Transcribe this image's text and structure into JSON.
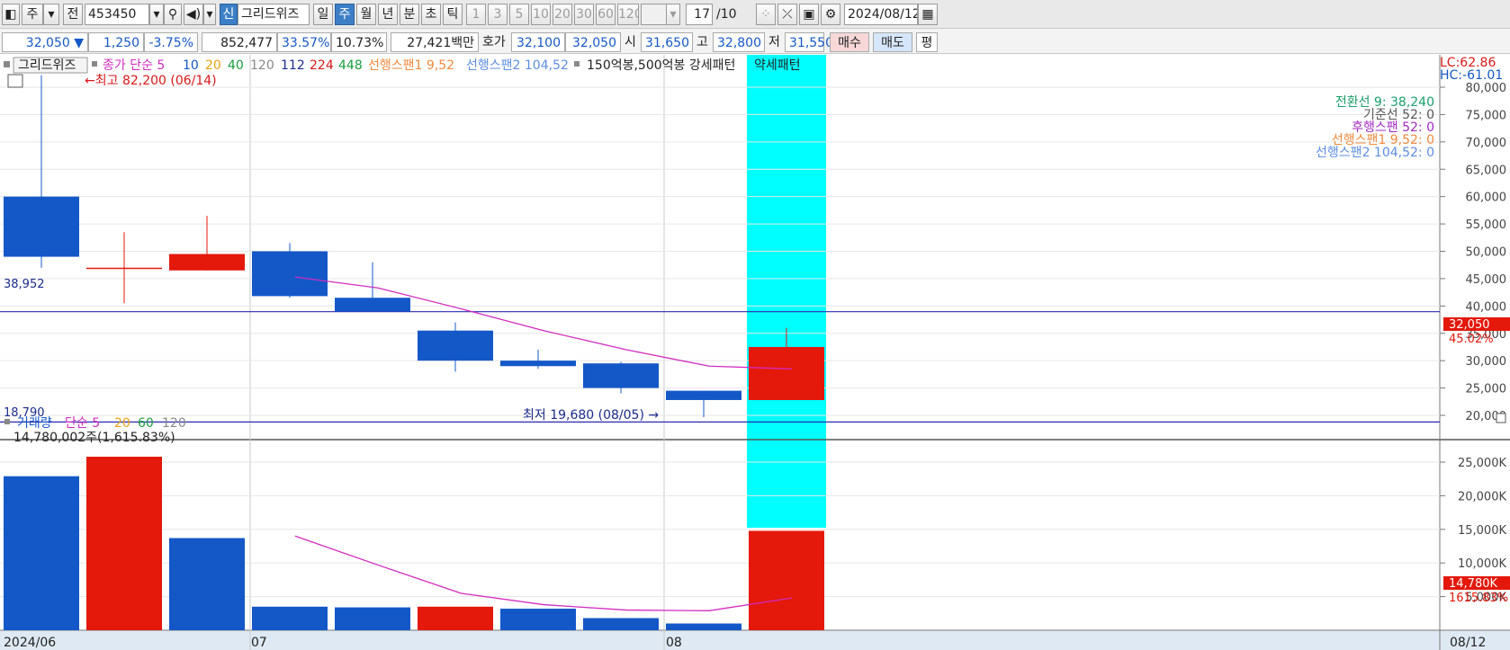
{
  "toolbar": {
    "period_label": "주",
    "prev_label": "전",
    "code": "453450",
    "new_label": "신",
    "indicator_name": "그리드위즈",
    "day_label": "일",
    "week_label": "주",
    "month_label": "월",
    "year_label": "년",
    "minute_label": "분",
    "second_label": "초",
    "tick_label": "틱",
    "numbers": [
      "1",
      "3",
      "5",
      "10",
      "20",
      "30",
      "60",
      "120"
    ],
    "count": "17",
    "count_total": "/10",
    "date": "2024/08/12"
  },
  "info": {
    "price": "32,050 ▼",
    "change": "1,250",
    "change_pct": "-3.75%",
    "volume": "852,477",
    "vol_pct": "33.57%",
    "turnover": "10.73%",
    "amount": "27,421백만",
    "hoga_label": "호가",
    "ask": "32,100",
    "bid": "32,050",
    "open_label": "시",
    "open": "31,650",
    "high_label": "고",
    "high": "32,800",
    "low_label": "저",
    "low": "31,550",
    "buy_label": "매수",
    "sell_label": "매도",
    "eval_label": "평"
  },
  "legend": {
    "name": "그리드위즈",
    "close_ma": "종가 단순 5",
    "ma10": "10",
    "ma20": "20",
    "ma40": "40",
    "ma120": "120",
    "ma112": "112",
    "ma224": "224",
    "ma448": "448",
    "span1": "선행스팬1 9,52",
    "span2": "선행스팬2 104,52",
    "pattern": "150억봉,500억봉 강세패턴",
    "weak_pattern": "약세패턴"
  },
  "right_info": {
    "lc": "LC:62.86",
    "hc": "HC:-61.01",
    "conv": "전환선 9: 38,240",
    "base": "기준선 52: 0",
    "lag": "후행스팬 52: 0",
    "lead1": "선행스팬1 9,52: 0",
    "lead2": "선행스팬2 104,52: 0"
  },
  "annotations": {
    "high_marker": "←최고 82,200 (06/14)",
    "low_marker": "최저 19,680 (08/05) →",
    "line_hi_label": "38,952",
    "line_lo_label": "18,790",
    "price_tag": "32,050",
    "price_tag_pct": "45.02%",
    "vol_title": "거래량",
    "vol_ma": "단순 5",
    "vol_ma20": "20",
    "vol_ma60": "60",
    "vol_ma120": "120",
    "vol_value": "14,780,002주(1,615.83%)",
    "vol_tag": "14,780K",
    "vol_tag_pct": "1615.83%"
  },
  "x_labels": [
    "2024/06",
    "07",
    "08",
    "08/12"
  ],
  "colors": {
    "up": "#e4180b",
    "down": "#1458c8",
    "ma": "#d22bbf",
    "highlight": "#00ffff",
    "hline": "#2a2ab5"
  },
  "chart_data": {
    "type": "candlestick",
    "price_axis": {
      "ylim": [
        15000,
        85000
      ],
      "ticks": [
        20000,
        25000,
        30000,
        35000,
        40000,
        45000,
        50000,
        55000,
        60000,
        65000,
        70000,
        75000,
        80000
      ]
    },
    "candles": [
      {
        "open": 60000,
        "high": 82200,
        "low": 47000,
        "close": 49000
      },
      {
        "open": 47000,
        "high": 53500,
        "low": 40500,
        "close": 47000
      },
      {
        "open": 46500,
        "high": 56500,
        "low": 46500,
        "close": 49500
      },
      {
        "open": 50000,
        "high": 51500,
        "low": 41500,
        "close": 41800
      },
      {
        "open": 41500,
        "high": 48000,
        "low": 39000,
        "close": 39000
      },
      {
        "open": 35500,
        "high": 37000,
        "low": 28000,
        "close": 30000
      },
      {
        "open": 30000,
        "high": 32000,
        "low": 28500,
        "close": 29000
      },
      {
        "open": 29500,
        "high": 29800,
        "low": 24000,
        "close": 25000
      },
      {
        "open": 24500,
        "high": 24500,
        "low": 19680,
        "close": 22800
      },
      {
        "open": 22800,
        "high": 36000,
        "low": 22800,
        "close": 32500
      }
    ],
    "ma5": [
      null,
      null,
      null,
      45300,
      43300,
      39500,
      35500,
      32000,
      29000,
      28500
    ],
    "hlines": [
      38952,
      18790
    ],
    "volume_axis": {
      "ylim": [
        0,
        27000
      ],
      "ticks": [
        5000,
        10000,
        15000,
        20000,
        25000
      ],
      "unit": "K"
    },
    "volume": [
      {
        "value": 22900,
        "dir": "down"
      },
      {
        "value": 25800,
        "dir": "up"
      },
      {
        "value": 13700,
        "dir": "down"
      },
      {
        "value": 3500,
        "dir": "down"
      },
      {
        "value": 3400,
        "dir": "down"
      },
      {
        "value": 3500,
        "dir": "up"
      },
      {
        "value": 3200,
        "dir": "down"
      },
      {
        "value": 1800,
        "dir": "down"
      },
      {
        "value": 1000,
        "dir": "down"
      },
      {
        "value": 14780,
        "dir": "up"
      }
    ],
    "vol_ma5": [
      null,
      null,
      null,
      14000,
      9700,
      5500,
      3800,
      3000,
      2900,
      4800
    ]
  }
}
